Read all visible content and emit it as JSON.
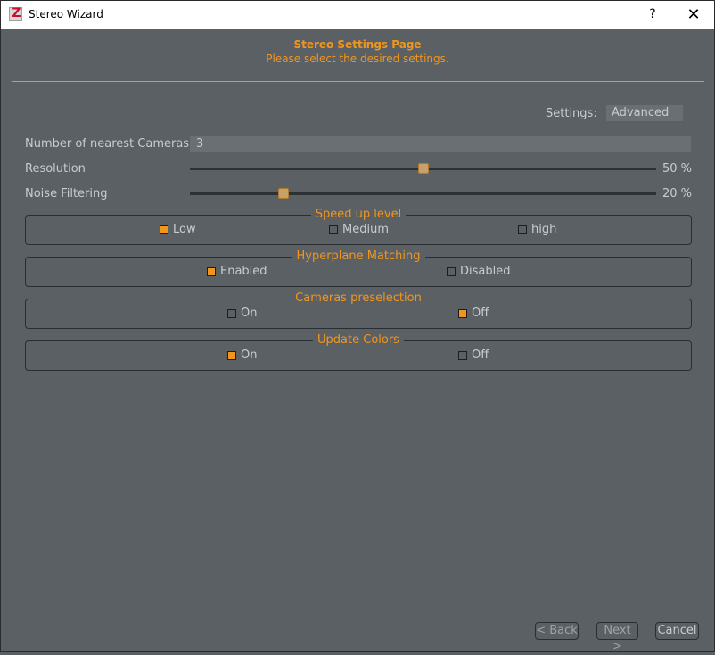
{
  "window": {
    "title": "Stereo Wizard",
    "help_glyph": "?",
    "close_glyph": "✕",
    "app_icon_letter": "Z"
  },
  "header": {
    "title": "Stereo Settings Page",
    "subtitle": "Please select the desired settings."
  },
  "settings": {
    "label": "Settings:",
    "value": "Advanced"
  },
  "cameras": {
    "label": "Number of nearest Cameras",
    "value": "3"
  },
  "resolution": {
    "label": "Resolution",
    "value": 50,
    "value_text": "50 %"
  },
  "noise": {
    "label": "Noise Filtering",
    "value": 20,
    "value_text": "20 %"
  },
  "groups": [
    {
      "title": "Speed up level",
      "options": [
        {
          "label": "Low",
          "checked": true
        },
        {
          "label": "Medium",
          "checked": false
        },
        {
          "label": "high",
          "checked": false
        }
      ]
    },
    {
      "title": "Hyperplane Matching",
      "options": [
        {
          "label": "Enabled",
          "checked": true
        },
        {
          "label": "Disabled",
          "checked": false
        }
      ]
    },
    {
      "title": "Cameras preselection",
      "options": [
        {
          "label": "On",
          "checked": false
        },
        {
          "label": "Off",
          "checked": true
        }
      ]
    },
    {
      "title": "Update Colors",
      "options": [
        {
          "label": "On",
          "checked": true
        },
        {
          "label": "Off",
          "checked": false
        }
      ]
    }
  ],
  "footer": {
    "back_label": "< Back",
    "next_label": "Next >",
    "cancel_label": "Cancel"
  },
  "colors": {
    "accent": "#f0961e",
    "background": "#5b6065",
    "text": "#c9ccce"
  }
}
